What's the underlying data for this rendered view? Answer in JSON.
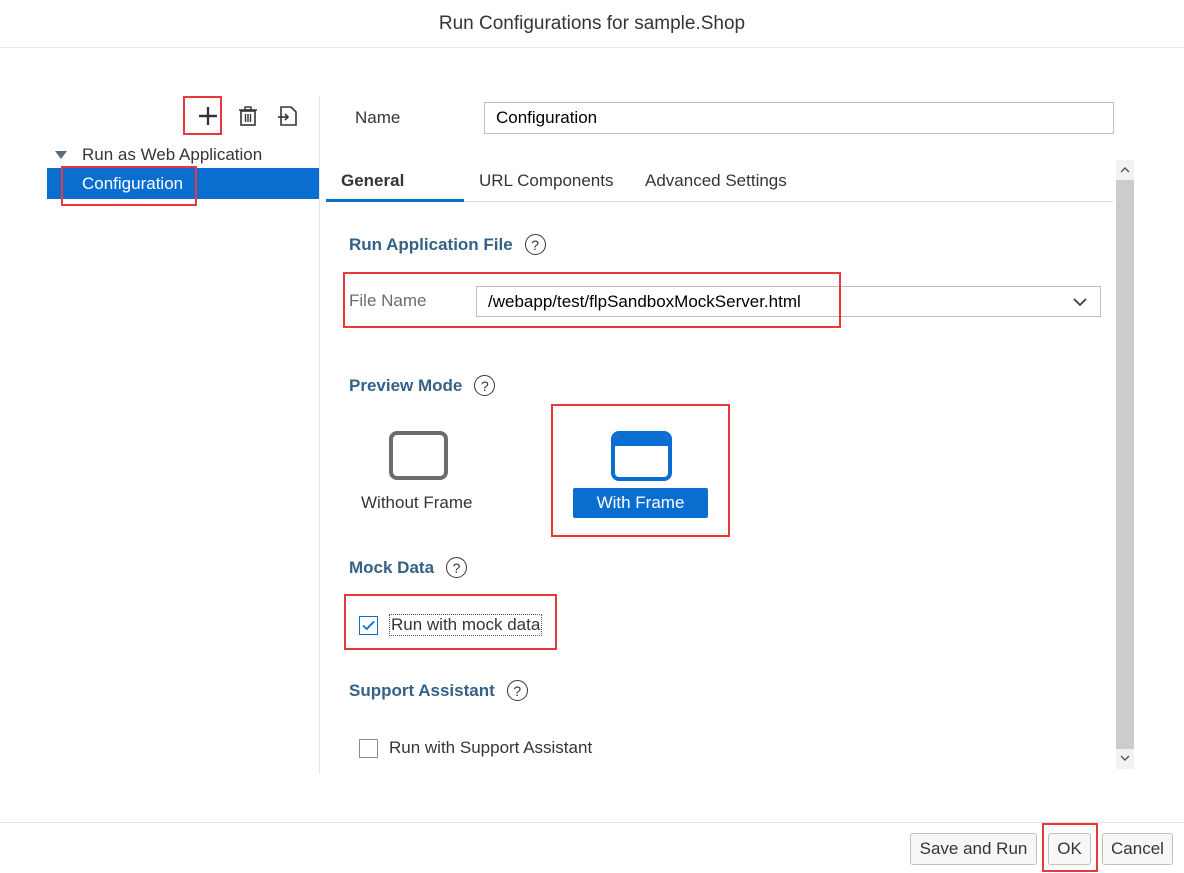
{
  "window": {
    "title": "Run Configurations for sample.Shop"
  },
  "toolbar": {
    "add_icon": "plus-icon",
    "delete_icon": "trash-icon",
    "import_icon": "import-icon"
  },
  "tree": {
    "parent": "Run as Web Application",
    "child": "Configuration"
  },
  "name_field": {
    "label": "Name",
    "value": "Configuration"
  },
  "tabs": [
    {
      "label": "General",
      "active": true
    },
    {
      "label": "URL Components",
      "active": false
    },
    {
      "label": "Advanced Settings",
      "active": false
    }
  ],
  "run_app_file": {
    "title": "Run Application File",
    "field_label": "File Name",
    "selected_value": "/webapp/test/flpSandboxMockServer.html"
  },
  "preview_mode": {
    "title": "Preview Mode",
    "without_frame": "Without Frame",
    "with_frame": "With Frame",
    "selected": "With Frame"
  },
  "mock_data": {
    "title": "Mock Data",
    "checkbox_label": "Run with mock data",
    "checked": true
  },
  "support_assistant": {
    "title": "Support Assistant",
    "checkbox_label": "Run with Support Assistant",
    "checked": false
  },
  "footer": {
    "save_and_run": "Save and Run",
    "ok": "OK",
    "cancel": "Cancel"
  },
  "colors": {
    "accent": "#0a6ed1",
    "section_title": "#346187",
    "highlight_box": "#e8373d"
  }
}
